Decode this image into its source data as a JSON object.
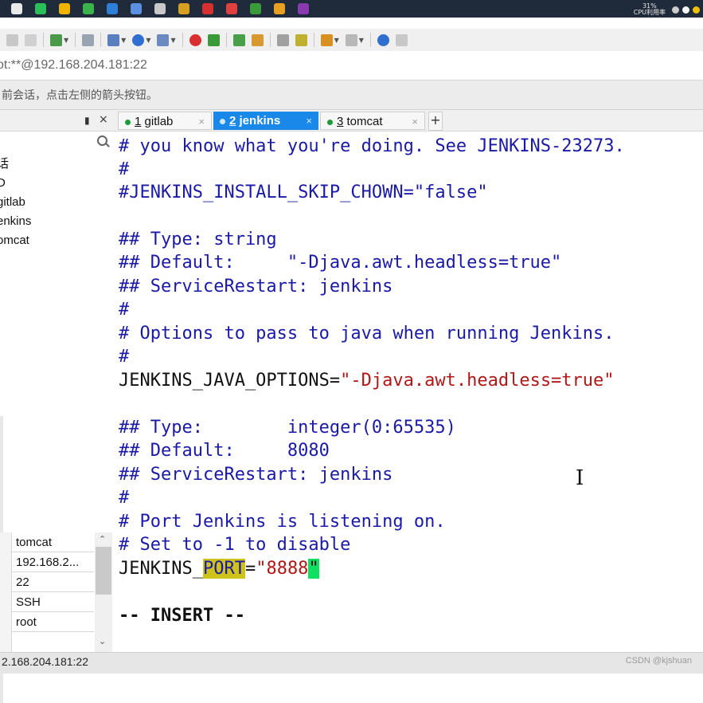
{
  "taskbar": {
    "cpu_percent": "31%",
    "cpu_label": "CPU利用率",
    "icons": [
      "windows-icon",
      "wechat-icon",
      "folder-icon",
      "browser-icon",
      "store-icon",
      "photos-icon",
      "brush-icon",
      "tools-icon",
      "vs-icon",
      "game-icon",
      "xshell-icon",
      "chrome-icon",
      "terminal-icon"
    ]
  },
  "address": {
    "text": "ot:**@192.168.204.181:22"
  },
  "hint": {
    "text": "前会话，点击左侧的箭头按钮。"
  },
  "session_panel": {
    "pin_glyph": "ᵖ",
    "close_glyph": "×",
    "tree": [
      "话",
      "D",
      "gitlab",
      "enkins",
      "omcat"
    ]
  },
  "properties": {
    "rows": [
      "tomcat",
      "192.168.2...",
      "22",
      "SSH",
      "root"
    ]
  },
  "tabs": [
    {
      "num": "1",
      "label": "gitlab"
    },
    {
      "num": "2",
      "label": "jenkins"
    },
    {
      "num": "3",
      "label": "tomcat"
    }
  ],
  "tab_close": "×",
  "tab_add": "+",
  "terminal": {
    "l01": "# you know what you're doing. See JENKINS-23273.",
    "l02": "#",
    "l03": "#JENKINS_INSTALL_SKIP_CHOWN=\"false\"",
    "l05": "## Type: string",
    "l06": "## Default:     \"-Djava.awt.headless=true\"",
    "l07": "## ServiceRestart: jenkins",
    "l08": "#",
    "l09": "# Options to pass to java when running Jenkins.",
    "l10": "#",
    "l11a": "JENKINS_JAVA_OPTIONS=",
    "l11b": "\"-Djava.awt.headless=true\"",
    "l13": "## Type:        integer(0:65535)",
    "l14": "## Default:     8080",
    "l15": "## ServiceRestart: jenkins",
    "l16": "#",
    "l17": "# Port Jenkins is listening on.",
    "l18": "# Set to -1 to disable",
    "l19a": "JENKINS_",
    "l19b": "PORT",
    "l19c": "=",
    "l19d": "\"8888",
    "l19e": "\"",
    "mode": "-- INSERT --"
  },
  "status": {
    "text": "2.168.204.181:22"
  },
  "watermark": "CSDN @kjshuan",
  "colors": {
    "comment": "#1a1aa6",
    "string": "#b01818",
    "search_highlight": "#cfc21a",
    "cursor": "#10e060",
    "active_tab": "#1a88e8"
  }
}
